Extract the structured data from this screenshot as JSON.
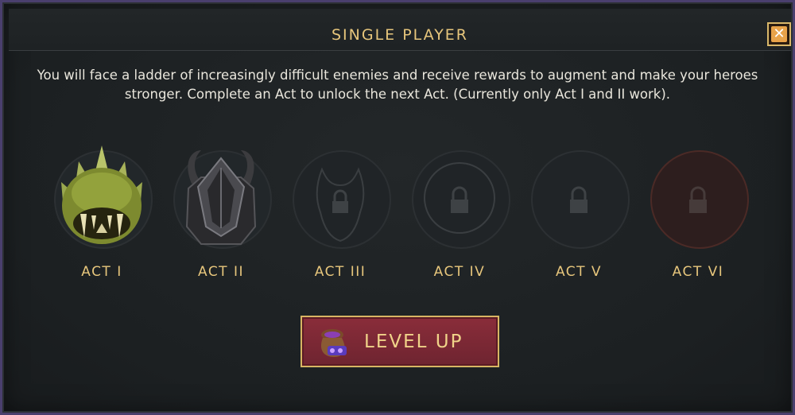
{
  "window": {
    "title": "SINGLE PLAYER",
    "close_icon": "close-icon"
  },
  "description": "You will face a ladder of increasingly difficult enemies and receive rewards to augment and make your heroes stronger.   Complete an Act to unlock the next Act.  (Currently only Act I and II work).",
  "acts": [
    {
      "label": "ACT I",
      "icon": "green-monster-icon",
      "locked": false
    },
    {
      "label": "ACT II",
      "icon": "horned-helmet-icon",
      "locked": false
    },
    {
      "label": "ACT III",
      "icon": "lock-icon",
      "locked": true
    },
    {
      "label": "ACT IV",
      "icon": "lock-icon",
      "locked": true
    },
    {
      "label": "ACT V",
      "icon": "lock-icon",
      "locked": true
    },
    {
      "label": "ACT VI",
      "icon": "lock-icon",
      "locked": true
    }
  ],
  "level_up": {
    "label": "LEVEL UP",
    "icon": "loot-bag-icon"
  },
  "colors": {
    "accent": "#e7c67c",
    "button": "#7c2834",
    "background": "#1e2224"
  }
}
